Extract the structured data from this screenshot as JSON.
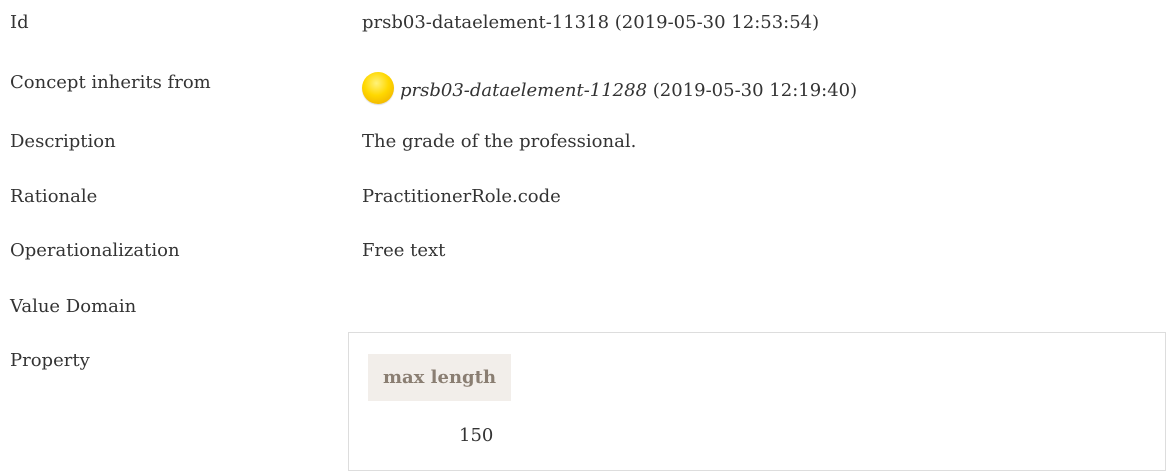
{
  "rows": {
    "id": {
      "label": "Id",
      "value": "prsb03-dataelement-11318 (2019-05-30 12:53:54)"
    },
    "inherits": {
      "label": "Concept inherits from",
      "status_icon": "yellow-circle-icon",
      "link_text": "prsb03-dataelement-11288",
      "link_suffix": " (2019-05-30 12:19:40)"
    },
    "description": {
      "label": "Description",
      "value": "The grade of the professional."
    },
    "rationale": {
      "label": "Rationale",
      "value": "PractitionerRole.code"
    },
    "operationalization": {
      "label": "Operationalization",
      "value": "Free text"
    },
    "value_domain": {
      "label": "Value Domain",
      "value": ""
    },
    "property": {
      "label": "Property",
      "header": "max length",
      "value": "150"
    }
  },
  "colors": {
    "text": "#333333",
    "header_bg": "#f2eeea",
    "header_text": "#8a7e72",
    "status_yellow": "#ffd800",
    "border": "#dddddd"
  }
}
